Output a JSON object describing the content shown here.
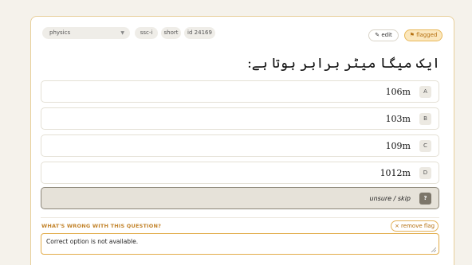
{
  "topbar": {
    "subject": "physics",
    "tags": [
      "ssc-i",
      "short",
      "id 24169"
    ],
    "edit_label": "✎ edit",
    "flagged_label": "⚑ flagged"
  },
  "question": {
    "text": "ایک میگا میٹر برابر ہوتا ہے:"
  },
  "options": [
    {
      "key": "A",
      "text": "106m"
    },
    {
      "key": "B",
      "text": "103m"
    },
    {
      "key": "C",
      "text": "109m"
    },
    {
      "key": "D",
      "text": "1012m"
    },
    {
      "key": "?",
      "text": "unsure / skip"
    }
  ],
  "feedback": {
    "label": "WHAT'S WRONG WITH THIS QUESTION?",
    "remove_label": "× remove flag",
    "value": "Correct option is not available."
  },
  "colors": {
    "accent": "#c2832a",
    "flag_bg": "#fbe7bd",
    "card_border": "#e8cf9a",
    "background": "#f5f2eb"
  }
}
